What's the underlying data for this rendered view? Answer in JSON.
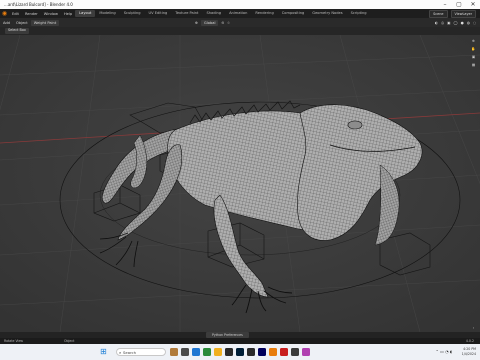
{
  "window": {
    "title": "...ard\\Lizard Bulcord] - Blender 4.0"
  },
  "topbar": {
    "menus": [
      "Edit",
      "Render",
      "Window",
      "Help"
    ],
    "workspace_tabs": [
      "Layout",
      "Modeling",
      "Sculpting",
      "UV Editing",
      "Texture Paint",
      "Shading",
      "Animation",
      "Rendering",
      "Compositing",
      "Geometry Nodes",
      "Scripting"
    ],
    "active_tab": "Layout",
    "scene_label": "Scene",
    "layer_label": "ViewLayer"
  },
  "header": {
    "buttons": [
      "Add",
      "Object"
    ],
    "mode": "Weight Paint",
    "orientation": "Global"
  },
  "toolheader": {
    "select_mode": "Select Box"
  },
  "status": {
    "center_button": "Python Preferences",
    "left": "Rotate View",
    "object": "Object",
    "version": "4.0.2"
  },
  "taskbar": {
    "search_placeholder": "Search",
    "time": "4:20 PM",
    "date": "1/4/2024"
  },
  "colors": {
    "viewport_bg": "#3c3c3c",
    "mesh_fill": "#a9a9a9",
    "wire": "#1c1c1c",
    "accent": "#e87d0d"
  }
}
